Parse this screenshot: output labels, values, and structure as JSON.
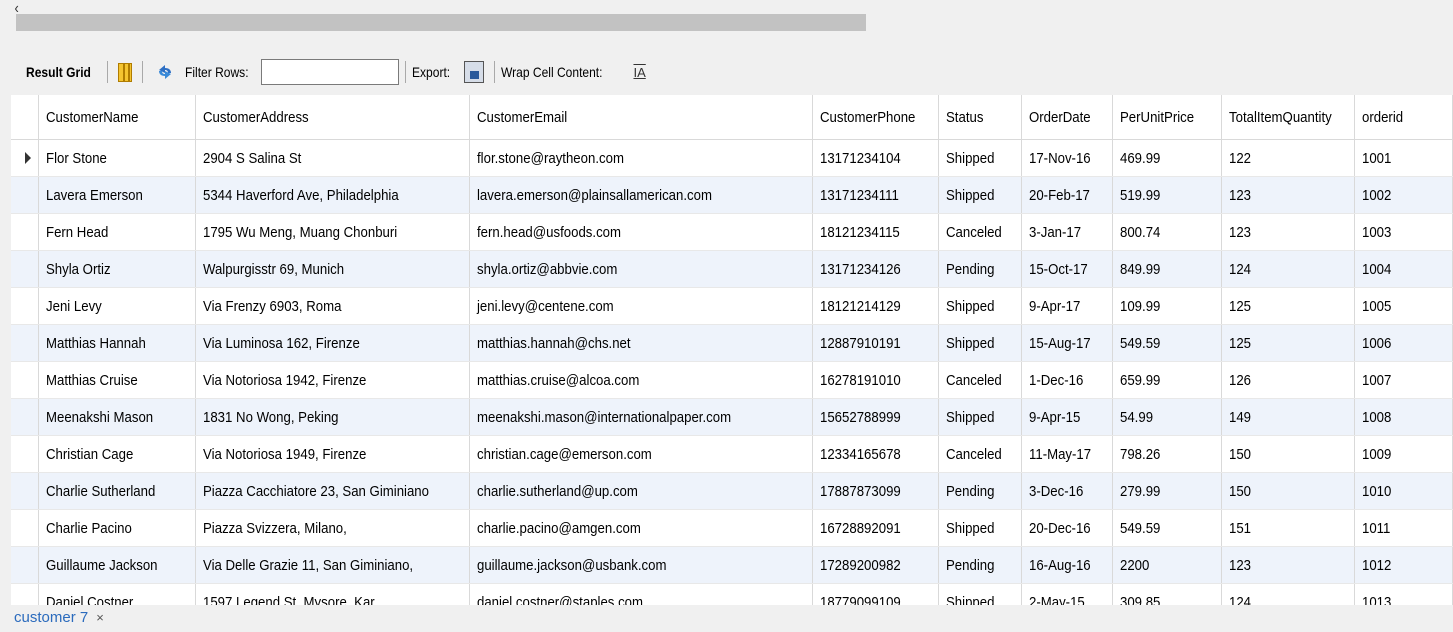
{
  "toolbar": {
    "result_grid_label": "Result Grid",
    "filter_rows_label": "Filter Rows:",
    "filter_value": "",
    "export_label": "Export:",
    "wrap_label": "Wrap Cell Content:",
    "wrap_icon_glyph": "IA"
  },
  "table": {
    "columns": [
      "CustomerName",
      "CustomerAddress",
      "CustomerEmail",
      "CustomerPhone",
      "Status",
      "OrderDate",
      "PerUnitPrice",
      "TotalItemQuantity",
      "orderid"
    ],
    "rows": [
      [
        "Flor Stone",
        "2904 S Salina St",
        "flor.stone@raytheon.com",
        "13171234104",
        "Shipped",
        "17-Nov-16",
        "469.99",
        "122",
        "1001"
      ],
      [
        "Lavera Emerson",
        "5344 Haverford Ave, Philadelphia",
        "lavera.emerson@plainsallamerican.com",
        "13171234111",
        "Shipped",
        "20-Feb-17",
        "519.99",
        "123",
        "1002"
      ],
      [
        "Fern Head",
        "1795 Wu Meng, Muang Chonburi",
        "fern.head@usfoods.com",
        "18121234115",
        "Canceled",
        "3-Jan-17",
        "800.74",
        "123",
        "1003"
      ],
      [
        "Shyla Ortiz",
        "Walpurgisstr 69, Munich",
        "shyla.ortiz@abbvie.com",
        "13171234126",
        "Pending",
        "15-Oct-17",
        "849.99",
        "124",
        "1004"
      ],
      [
        "Jeni Levy",
        "Via Frenzy 6903, Roma",
        "jeni.levy@centene.com",
        "18121214129",
        "Shipped",
        "9-Apr-17",
        "109.99",
        "125",
        "1005"
      ],
      [
        "Matthias Hannah",
        "Via Luminosa 162, Firenze",
        "matthias.hannah@chs.net",
        "12887910191",
        "Shipped",
        "15-Aug-17",
        "549.59",
        "125",
        "1006"
      ],
      [
        "Matthias Cruise",
        "Via Notoriosa 1942, Firenze",
        "matthias.cruise@alcoa.com",
        "16278191010",
        "Canceled",
        "1-Dec-16",
        "659.99",
        "126",
        "1007"
      ],
      [
        "Meenakshi Mason",
        "1831 No Wong, Peking",
        "meenakshi.mason@internationalpaper.com",
        "15652788999",
        "Shipped",
        "9-Apr-15",
        "54.99",
        "149",
        "1008"
      ],
      [
        "Christian Cage",
        "Via Notoriosa 1949, Firenze",
        "christian.cage@emerson.com",
        "12334165678",
        "Canceled",
        "11-May-17",
        "798.26",
        "150",
        "1009"
      ],
      [
        "Charlie Sutherland",
        "Piazza Cacchiatore 23, San Giminiano",
        "charlie.sutherland@up.com",
        "17887873099",
        "Pending",
        "3-Dec-16",
        "279.99",
        "150",
        "1010"
      ],
      [
        "Charlie Pacino",
        "Piazza Svizzera, Milano,",
        "charlie.pacino@amgen.com",
        "16728892091",
        "Shipped",
        "20-Dec-16",
        "549.59",
        "151",
        "1011"
      ],
      [
        "Guillaume Jackson",
        "Via Delle Grazie 11, San Giminiano,",
        "guillaume.jackson@usbank.com",
        "17289200982",
        "Pending",
        "16-Aug-16",
        "2200",
        "123",
        "1012"
      ],
      [
        "Daniel Costner",
        "1597 Legend St, Mysore, Kar",
        "daniel.costner@staples.com",
        "18779099109",
        "Shipped",
        "2-May-15",
        "309.85",
        "124",
        "1013"
      ]
    ]
  },
  "tab": {
    "label": "customer 7",
    "close_glyph": "×"
  },
  "colors": {
    "alt_row": "#eef3fb",
    "tab_text": "#2b6bbd"
  }
}
